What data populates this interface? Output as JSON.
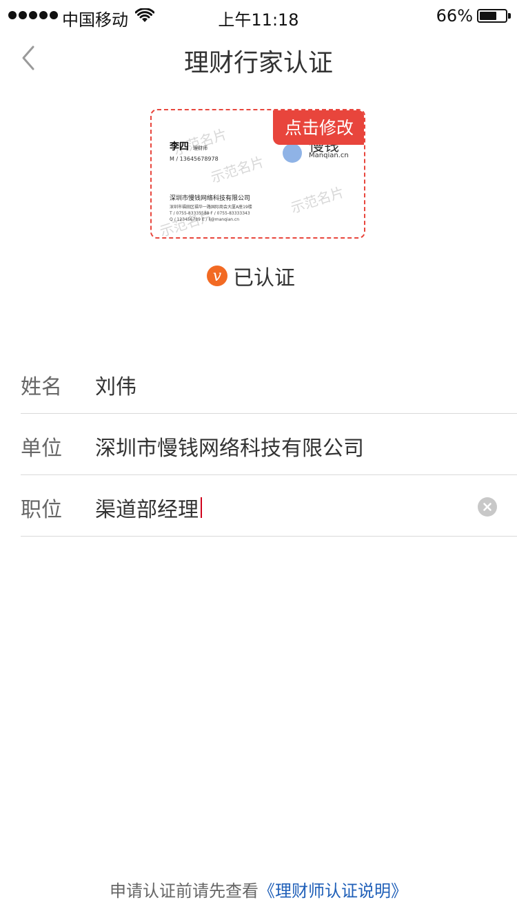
{
  "status_bar": {
    "carrier": "中国移动",
    "time": "上午11:18",
    "battery_percent": "66%",
    "battery_level": 0.66
  },
  "nav": {
    "title": "理财行家认证"
  },
  "card": {
    "name": "李四",
    "role": "理财师",
    "mobile": "M / 13645678978",
    "brand": "慢钱",
    "domain": "Manqian.cn",
    "company": "深圳市慢钱网络科技有限公司",
    "address_line1": "深圳市福田区福华一路国际商会大厦A座19楼",
    "address_line2": "T / 0755-83335588    F / 0755-83333343",
    "address_line3": "Q / 123456789        E / li@manqian.cn",
    "watermark": "示范名片",
    "edit_label": "点击修改"
  },
  "verified": {
    "badge": "v",
    "label": "已认证"
  },
  "form": {
    "name": {
      "label": "姓名",
      "value": "刘伟"
    },
    "company": {
      "label": "单位",
      "value": "深圳市慢钱网络科技有限公司"
    },
    "position": {
      "label": "职位",
      "value": "渠道部经理"
    }
  },
  "footer": {
    "prefix": "申请认证前请先查看",
    "link": "《理财师认证说明》"
  },
  "colors": {
    "accent_red": "#e8453c",
    "link_blue": "#1f5fb8",
    "badge_orange": "#f26a23"
  }
}
